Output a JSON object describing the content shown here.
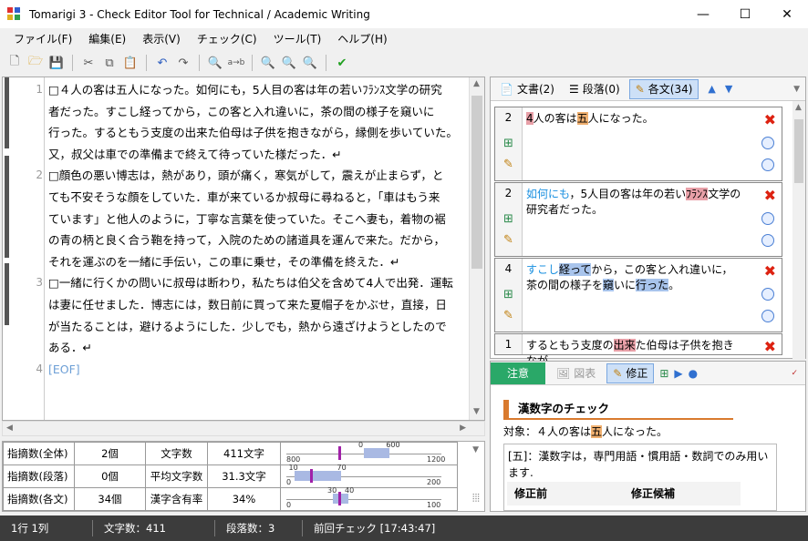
{
  "window": {
    "title": "Tomarigi 3 - Check Editor Tool for Technical / Academic Writing",
    "min": "—",
    "max": "☐",
    "close": "✕"
  },
  "menu": [
    "ファイル(F)",
    "編集(E)",
    "表示(V)",
    "チェック(C)",
    "ツール(T)",
    "ヘルプ(H)"
  ],
  "editor": {
    "lines": [
      {
        "num": "1",
        "text": "□４人の客は五人になった。如何にも，5人目の客は年の若いﾌﾗﾝｽ文学の研究"
      },
      {
        "num": "",
        "text": "者だった。すこし経ってから，この客と入れ違いに，茶の間の様子を窺いに"
      },
      {
        "num": "",
        "text": "行った。するともう支度の出来た伯母は子供を抱きながら，縁側を歩いていた。"
      },
      {
        "num": "",
        "text": "又，叔父は車での準備まで終えて待っていた様だった．↵"
      },
      {
        "num": "2",
        "text": "□顔色の悪い博志は，熱があり，頭が痛く，寒気がして，震えが止まらず，と"
      },
      {
        "num": "",
        "text": "ても不安そうな顔をしていた．車が来ているか叔母に尋ねると，「車はもう来"
      },
      {
        "num": "",
        "text": "ています」と他人のように，丁寧な言葉を使っていた。そこへ妻も，着物の裾"
      },
      {
        "num": "",
        "text": "の青の柄と良く合う鞄を持って，入院のための諸道具を運んで来た。だから，"
      },
      {
        "num": "",
        "text": "それを運ぶのを一緒に手伝い，この車に乗せ，その準備を終えた．↵"
      },
      {
        "num": "3",
        "text": "□一緒に行くかの問いに叔母は断わり，私たちは伯父を含めて4人で出発．運転"
      },
      {
        "num": "",
        "text": "は妻に任せました．博志には，数日前に買って来た夏帽子をかぶせ，直接，日"
      },
      {
        "num": "",
        "text": "が当たることは，避けるようにした．少しでも，熱から遠ざけようとしたので"
      },
      {
        "num": "",
        "text": "ある．↵"
      },
      {
        "num": "4",
        "text": "[EOF]"
      }
    ]
  },
  "stats": {
    "rows": [
      {
        "label": "指摘数(全体)",
        "value": "2個",
        "mlabel": "文字数",
        "mvalue": "411文字",
        "ticks": [
          "0",
          "600",
          "800",
          "1200"
        ],
        "range": [
          600,
          800
        ],
        "max": 1200,
        "mark": 411
      },
      {
        "label": "指摘数(段落)",
        "value": "0個",
        "mlabel": "平均文字数",
        "mvalue": "31.3文字",
        "ticks": [
          "10",
          "70",
          "0",
          "200"
        ],
        "range": [
          10,
          70
        ],
        "max": 200,
        "mark": 31.3
      },
      {
        "label": "指摘数(各文)",
        "value": "34個",
        "mlabel": "漢字含有率",
        "mvalue": "34%",
        "ticks": [
          "30",
          "40",
          "0",
          "100"
        ],
        "range": [
          30,
          40
        ],
        "max": 100,
        "mark": 34
      }
    ]
  },
  "rtabs": [
    {
      "label": "文書(2)"
    },
    {
      "label": "段落(0)"
    },
    {
      "label": "各文(34)"
    }
  ],
  "cards": [
    {
      "num": "2",
      "seg": [
        [
          "",
          ""
        ],
        [
          "4",
          "hl-r"
        ],
        [
          "人の客は",
          ""
        ],
        [
          "五",
          "hl-o"
        ],
        [
          "人になった。",
          ""
        ]
      ]
    },
    {
      "num": "2",
      "seg": [
        [
          "如何にも",
          "hl-c"
        ],
        [
          "，5人目の客は年の若い",
          ""
        ],
        [
          "ﾌﾗﾝｽ",
          "hl-r"
        ],
        [
          "文学の研究者だった。",
          ""
        ]
      ]
    },
    {
      "num": "4",
      "seg": [
        [
          "すこし",
          "hl-c"
        ],
        [
          "経って",
          "hl-b"
        ],
        [
          "から，この客と入れ違いに，茶の間の様子を",
          ""
        ],
        [
          "窺",
          "hl-b"
        ],
        [
          "いに",
          ""
        ],
        [
          "行った",
          "hl-b"
        ],
        [
          "。",
          ""
        ]
      ]
    },
    {
      "num": "1",
      "seg": [
        [
          "するともう支度の",
          ""
        ],
        [
          "出来",
          "hl-r"
        ],
        [
          "た伯母は子供を抱きなが",
          ""
        ]
      ]
    }
  ],
  "detail": {
    "notice": "注意",
    "tab2": "図表",
    "tab3": "修正",
    "heading": "漢数字のチェック",
    "target_prefix": "対象：４人の客は",
    "target_hl": "五",
    "target_suffix": "人になった。",
    "explain": "[五]：漢数字は，専門用語・慣用語・数詞でのみ用います.",
    "col1": "修正前",
    "col2": "修正候補"
  },
  "status": [
    "1行 1列",
    "文字数：411",
    "段落数：3",
    "前回チェック [17:43:47]"
  ],
  "colors": {
    "accent": "#2aa868",
    "change_bar": "#555555"
  }
}
